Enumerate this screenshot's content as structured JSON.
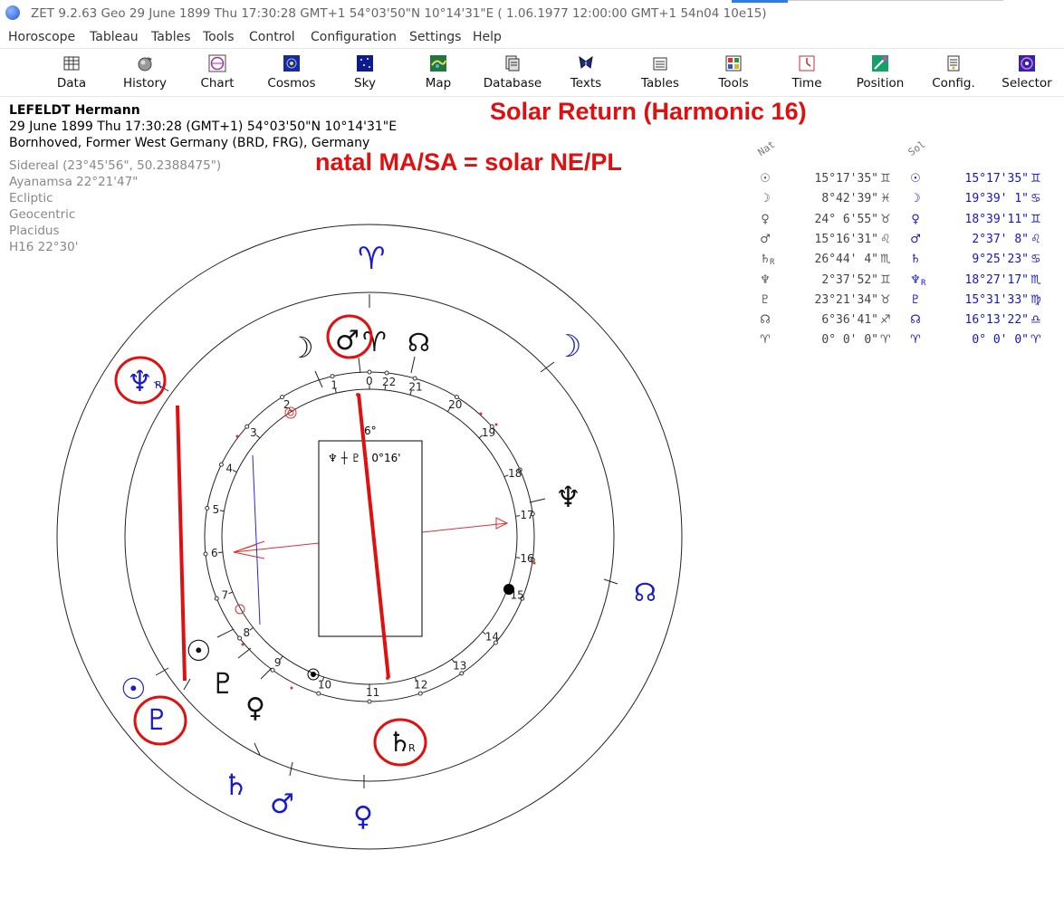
{
  "window": {
    "title": "ZET 9.2.63 Geo   29 June 1899  Thu   17:30:28 GMT+1  54°03'50\"N   10°14'31\"E   ( 1.06.1977   12:00:00 GMT+1  54n04  10e15)"
  },
  "menu": [
    "Horoscope",
    "Tableau",
    "Tables",
    "Tools",
    "Control",
    "Configuration",
    "Settings",
    "Help"
  ],
  "toolbar": [
    {
      "label": "Data",
      "icon": "data-grid-icon"
    },
    {
      "label": "History",
      "icon": "history-icon"
    },
    {
      "label": "Chart",
      "icon": "chart-wheel-icon"
    },
    {
      "label": "Cosmos",
      "icon": "cosmos-icon"
    },
    {
      "label": "Sky",
      "icon": "sky-icon"
    },
    {
      "label": "Map",
      "icon": "map-icon"
    },
    {
      "label": "Database",
      "icon": "database-icon"
    },
    {
      "label": "Texts",
      "icon": "texts-icon"
    },
    {
      "label": "Tables",
      "icon": "tables-icon"
    },
    {
      "label": "Tools",
      "icon": "tools-icon"
    },
    {
      "label": "Time",
      "icon": "time-icon"
    },
    {
      "label": "Position",
      "icon": "position-icon"
    },
    {
      "label": "Config.",
      "icon": "config-icon"
    },
    {
      "label": "Selector",
      "icon": "selector-icon"
    }
  ],
  "info": {
    "name": "LEFELDT Hermann",
    "datetime": "29 June 1899  Thu   17:30:28 (GMT+1) 54°03'50\"N   10°14'31\"E",
    "place": "Bornhoved, Former West Germany (BRD, FRG), Germany",
    "settings": [
      "Sidereal (23°45'56\", 50.2388475\")",
      "Ayanamsa 22°21'47\"",
      "Ecliptic",
      "Geocentric",
      "Placidus",
      "H16   22°30'"
    ]
  },
  "annotations": {
    "title": "Solar Return (Harmonic 16)",
    "subtitle": "natal MA/SA = solar NE/PL"
  },
  "chart": {
    "house_numbers": [
      "0",
      "1",
      "2",
      "3",
      "4",
      "5",
      "6",
      "7",
      "8",
      "9",
      "10",
      "11",
      "12",
      "13",
      "14",
      "15",
      "16",
      "17",
      "18",
      "19",
      "20",
      "21",
      "22"
    ],
    "midpoint_box_text": "♆ ┼ ♇  - 0°16'",
    "degree_label": "6°",
    "retro_marker": "R",
    "colors": {
      "natal": "#000000",
      "solar": "#1a1acc",
      "highlight": "#e01010",
      "aspect": "#e03030",
      "aspect_blue": "#2a2ad0"
    }
  },
  "positions_table": {
    "headers": {
      "natal": "Nat",
      "solar": "Sol"
    },
    "rows": [
      {
        "n_sym": "☉",
        "n_r": "",
        "n_val": "15°17'35\"",
        "n_sign": "♊",
        "s_sym": "☉",
        "s_r": "",
        "s_val": "15°17'35\"",
        "s_sign": "♊"
      },
      {
        "n_sym": "☽",
        "n_r": "",
        "n_val": "8°42'39\"",
        "n_sign": "♓",
        "s_sym": "☽",
        "s_r": "",
        "s_val": "19°39' 1\"",
        "s_sign": "♋"
      },
      {
        "n_sym": "♀",
        "n_r": "",
        "n_val": "24° 6'55\"",
        "n_sign": "♉",
        "s_sym": "♀",
        "s_r": "",
        "s_val": "18°39'11\"",
        "s_sign": "♊"
      },
      {
        "n_sym": "♂",
        "n_r": "",
        "n_val": "15°16'31\"",
        "n_sign": "♌",
        "s_sym": "♂",
        "s_r": "",
        "s_val": "2°37' 8\"",
        "s_sign": "♌"
      },
      {
        "n_sym": "♄",
        "n_r": "R",
        "n_val": "26°44' 4\"",
        "n_sign": "♏",
        "s_sym": "♄",
        "s_r": "",
        "s_val": "9°25'23\"",
        "s_sign": "♋"
      },
      {
        "n_sym": "♆",
        "n_r": "",
        "n_val": "2°37'52\"",
        "n_sign": "♊",
        "s_sym": "♆",
        "s_r": "R",
        "s_val": "18°27'17\"",
        "s_sign": "♏"
      },
      {
        "n_sym": "♇",
        "n_r": "",
        "n_val": "23°21'34\"",
        "n_sign": "♉",
        "s_sym": "♇",
        "s_r": "",
        "s_val": "15°31'33\"",
        "s_sign": "♍"
      },
      {
        "n_sym": "☊",
        "n_r": "",
        "n_val": "6°36'41\"",
        "n_sign": "♐",
        "s_sym": "☊",
        "s_r": "",
        "s_val": "16°13'22\"",
        "s_sign": "♎"
      },
      {
        "n_sym": "♈",
        "n_r": "",
        "n_val": "0° 0' 0\"",
        "n_sign": "♈",
        "s_sym": "♈",
        "s_r": "",
        "s_val": "0° 0' 0\"",
        "s_sign": "♈"
      }
    ]
  }
}
